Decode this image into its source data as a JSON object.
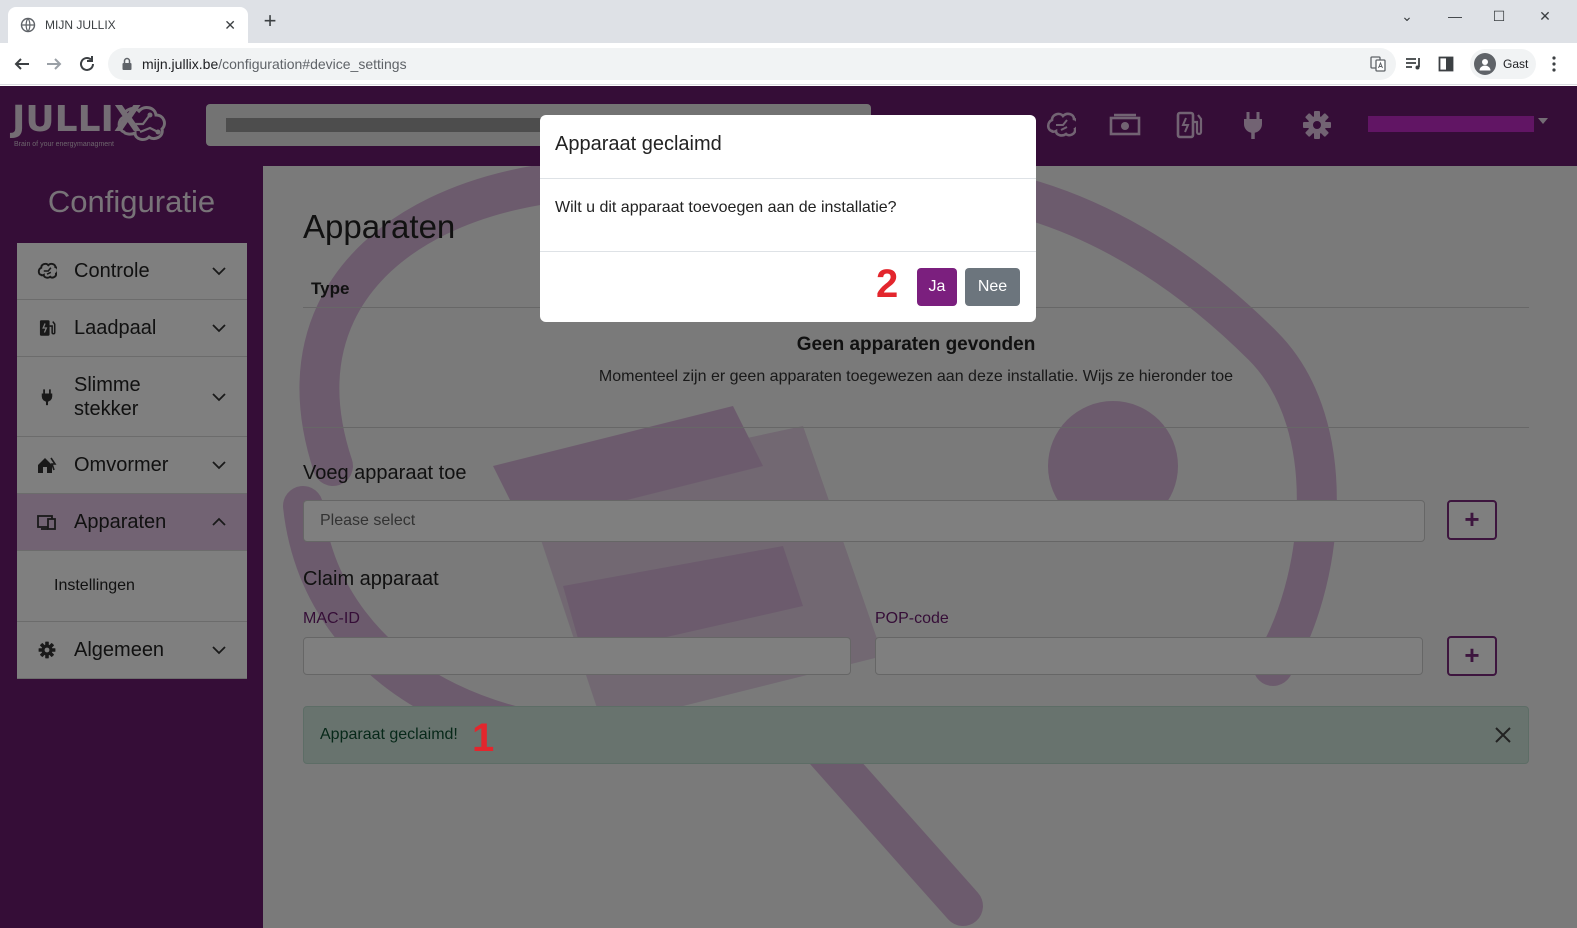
{
  "browser": {
    "tab_title": "MIJN JULLIX",
    "url_host": "mijn.jullix.be",
    "url_path": "/configuration#device_settings",
    "profile_label": "Gast"
  },
  "app": {
    "logo_text": "JULLIX",
    "logo_tagline": "Brain of your energymanagment",
    "nav_icons": [
      "brain-icon",
      "money-icon",
      "charging-station-icon",
      "plug-icon",
      "gear-icon"
    ]
  },
  "sidebar": {
    "title": "Configuratie",
    "items": [
      {
        "label": "Controle",
        "icon": "brain-icon",
        "state": "collapsed"
      },
      {
        "label": "Laadpaal",
        "icon": "charging-station-icon",
        "state": "collapsed"
      },
      {
        "label": "Slimme stekker",
        "icon": "plug-icon",
        "state": "collapsed"
      },
      {
        "label": "Omvormer",
        "icon": "house-solar-icon",
        "state": "collapsed"
      },
      {
        "label": "Apparaten",
        "icon": "devices-icon",
        "state": "expanded"
      },
      {
        "label": "Algemeen",
        "icon": "gear-icon",
        "state": "collapsed"
      }
    ],
    "submenu": {
      "label": "Instellingen"
    }
  },
  "main": {
    "heading": "Apparaten",
    "table_header_type": "Type",
    "empty_title": "Geen apparaten gevonden",
    "empty_desc": "Momenteel zijn er geen apparaten toegewezen aan deze installatie. Wijs ze hieronder toe",
    "add_heading": "Voeg apparaat toe",
    "select_placeholder": "Please select",
    "plus": "+",
    "claim_heading": "Claim apparaat",
    "mac_label": "MAC-ID",
    "pop_label": "POP-code",
    "alert_text": "Apparaat geclaimd!"
  },
  "annotations": {
    "one": "1",
    "two": "2"
  },
  "modal": {
    "title": "Apparaat geclaimd",
    "body": "Wilt u dit apparaat toevoegen aan de installatie?",
    "yes": "Ja",
    "no": "Nee"
  },
  "colors": {
    "brand": "#6b1a6e",
    "accent_button": "#7b1f7e",
    "secondary_button": "#6c757d",
    "alert_bg": "#d1e7dd",
    "annotation": "#e3262d"
  }
}
